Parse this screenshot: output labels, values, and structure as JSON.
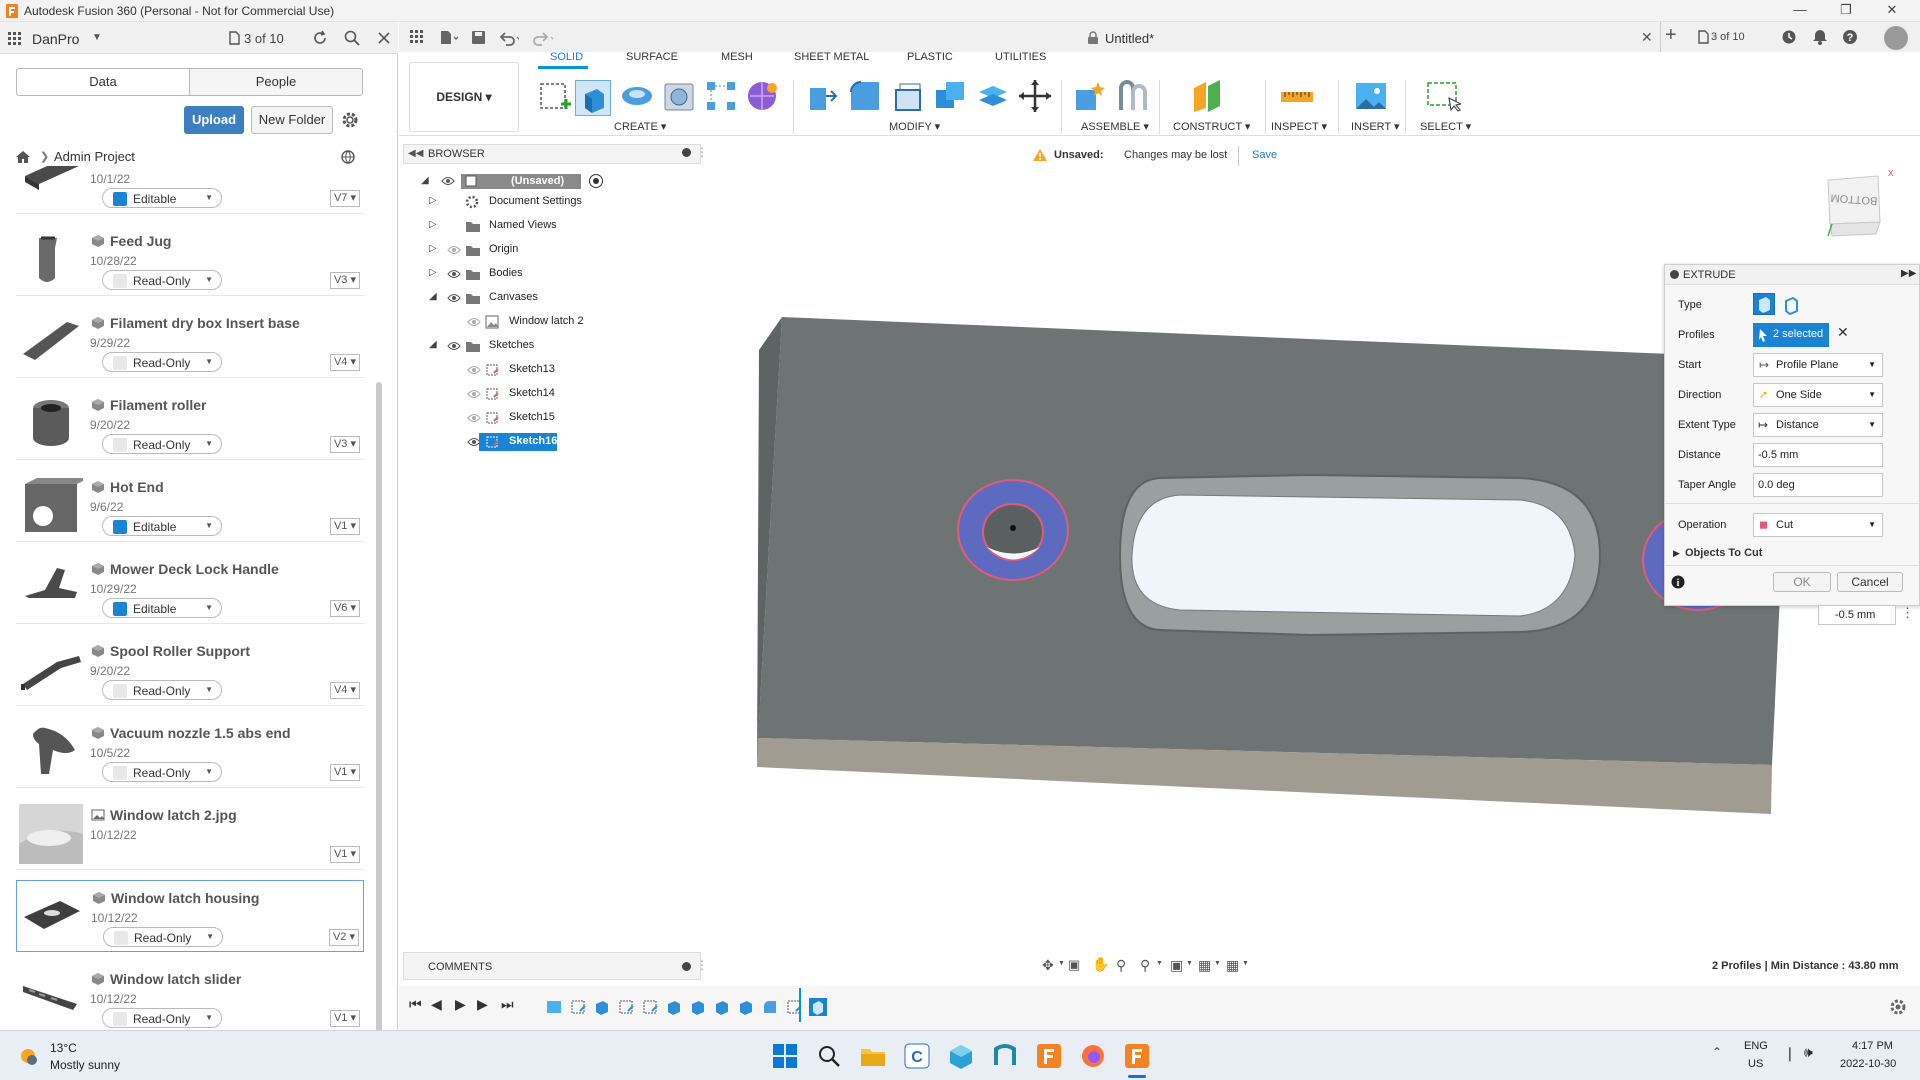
{
  "window": {
    "title": "Autodesk Fusion 360 (Personal - Not for Commercial Use)"
  },
  "left_header": {
    "user": "DanPro",
    "job_count": "3 of 10"
  },
  "data_tabs": {
    "data": "Data",
    "people": "People"
  },
  "actions": {
    "upload": "Upload",
    "new_folder": "New Folder"
  },
  "breadcrumb": {
    "project": "Admin Project"
  },
  "files": [
    {
      "name": "",
      "date": "10/1/22",
      "status": "Editable",
      "version": "V7",
      "kind": "design"
    },
    {
      "name": "Feed Jug",
      "date": "10/28/22",
      "status": "Read-Only",
      "version": "V3",
      "kind": "design"
    },
    {
      "name": "Filament dry box Insert base",
      "date": "9/29/22",
      "status": "Read-Only",
      "version": "V4",
      "kind": "design"
    },
    {
      "name": "Filament roller",
      "date": "9/20/22",
      "status": "Read-Only",
      "version": "V3",
      "kind": "design"
    },
    {
      "name": "Hot End",
      "date": "9/6/22",
      "status": "Editable",
      "version": "V1",
      "kind": "design"
    },
    {
      "name": "Mower Deck Lock Handle",
      "date": "10/29/22",
      "status": "Editable",
      "version": "V6",
      "kind": "design"
    },
    {
      "name": "Spool Roller Support",
      "date": "9/20/22",
      "status": "Read-Only",
      "version": "V4",
      "kind": "design"
    },
    {
      "name": "Vacuum nozzle 1.5 abs end",
      "date": "10/5/22",
      "status": "Read-Only",
      "version": "V1",
      "kind": "design"
    },
    {
      "name": "Window latch 2.jpg",
      "date": "10/12/22",
      "status": "",
      "version": "V1",
      "kind": "image"
    },
    {
      "name": "Window latch housing",
      "date": "10/12/22",
      "status": "Read-Only",
      "version": "V2",
      "kind": "design"
    },
    {
      "name": "Window latch slider",
      "date": "10/12/22",
      "status": "Read-Only",
      "version": "V1",
      "kind": "design"
    }
  ],
  "document": {
    "title": "Untitled*",
    "job_count": "3 of 10"
  },
  "workspace": {
    "mode": "DESIGN"
  },
  "tabs": [
    "SOLID",
    "SURFACE",
    "MESH",
    "SHEET METAL",
    "PLASTIC",
    "UTILITIES"
  ],
  "active_tab": "SOLID",
  "tool_groups": [
    "CREATE",
    "MODIFY",
    "ASSEMBLE",
    "CONSTRUCT",
    "INSPECT",
    "INSERT",
    "SELECT"
  ],
  "browser": {
    "title": "BROWSER",
    "root": "(Unsaved)",
    "items": [
      {
        "label": "Document Settings",
        "level": 1
      },
      {
        "label": "Named Views",
        "level": 1
      },
      {
        "label": "Origin",
        "level": 1
      },
      {
        "label": "Bodies",
        "level": 1
      },
      {
        "label": "Canvases",
        "level": 1
      },
      {
        "label": "Window latch 2",
        "level": 2
      },
      {
        "label": "Sketches",
        "level": 1
      },
      {
        "label": "Sketch13",
        "level": 2
      },
      {
        "label": "Sketch14",
        "level": 2
      },
      {
        "label": "Sketch15",
        "level": 2
      },
      {
        "label": "Sketch16",
        "level": 2,
        "selected": true
      }
    ]
  },
  "unsaved_banner": {
    "label": "Unsaved:",
    "message": "Changes may be lost",
    "save": "Save"
  },
  "viewcube": {
    "face": "BOTTOM"
  },
  "extrude": {
    "title": "EXTRUDE",
    "type_label": "Type",
    "profiles_label": "Profiles",
    "profiles_value": "2 selected",
    "start_label": "Start",
    "start_value": "Profile Plane",
    "direction_label": "Direction",
    "direction_value": "One Side",
    "extent_label": "Extent Type",
    "extent_value": "Distance",
    "distance_label": "Distance",
    "distance_value": "-0.5 mm",
    "taper_label": "Taper Angle",
    "taper_value": "0.0 deg",
    "operation_label": "Operation",
    "operation_value": "Cut",
    "objects_label": "Objects To Cut",
    "ok": "OK",
    "cancel": "Cancel"
  },
  "viewport_input": {
    "distance": "-0.5 mm"
  },
  "status": {
    "message": "2 Profiles | Min Distance : 43.80 mm"
  },
  "comments": {
    "label": "COMMENTS"
  },
  "taskbar": {
    "weather_temp": "13°C",
    "weather_desc": "Mostly sunny",
    "lang": "ENG",
    "region": "US",
    "time": "4:17 PM",
    "date": "2022-10-30"
  },
  "colors": {
    "accent": "#0696d7",
    "upload": "#3e7fc1",
    "selection": "#5c6bc0",
    "body_top": "#6e7474",
    "body_side": "#a19c92"
  }
}
